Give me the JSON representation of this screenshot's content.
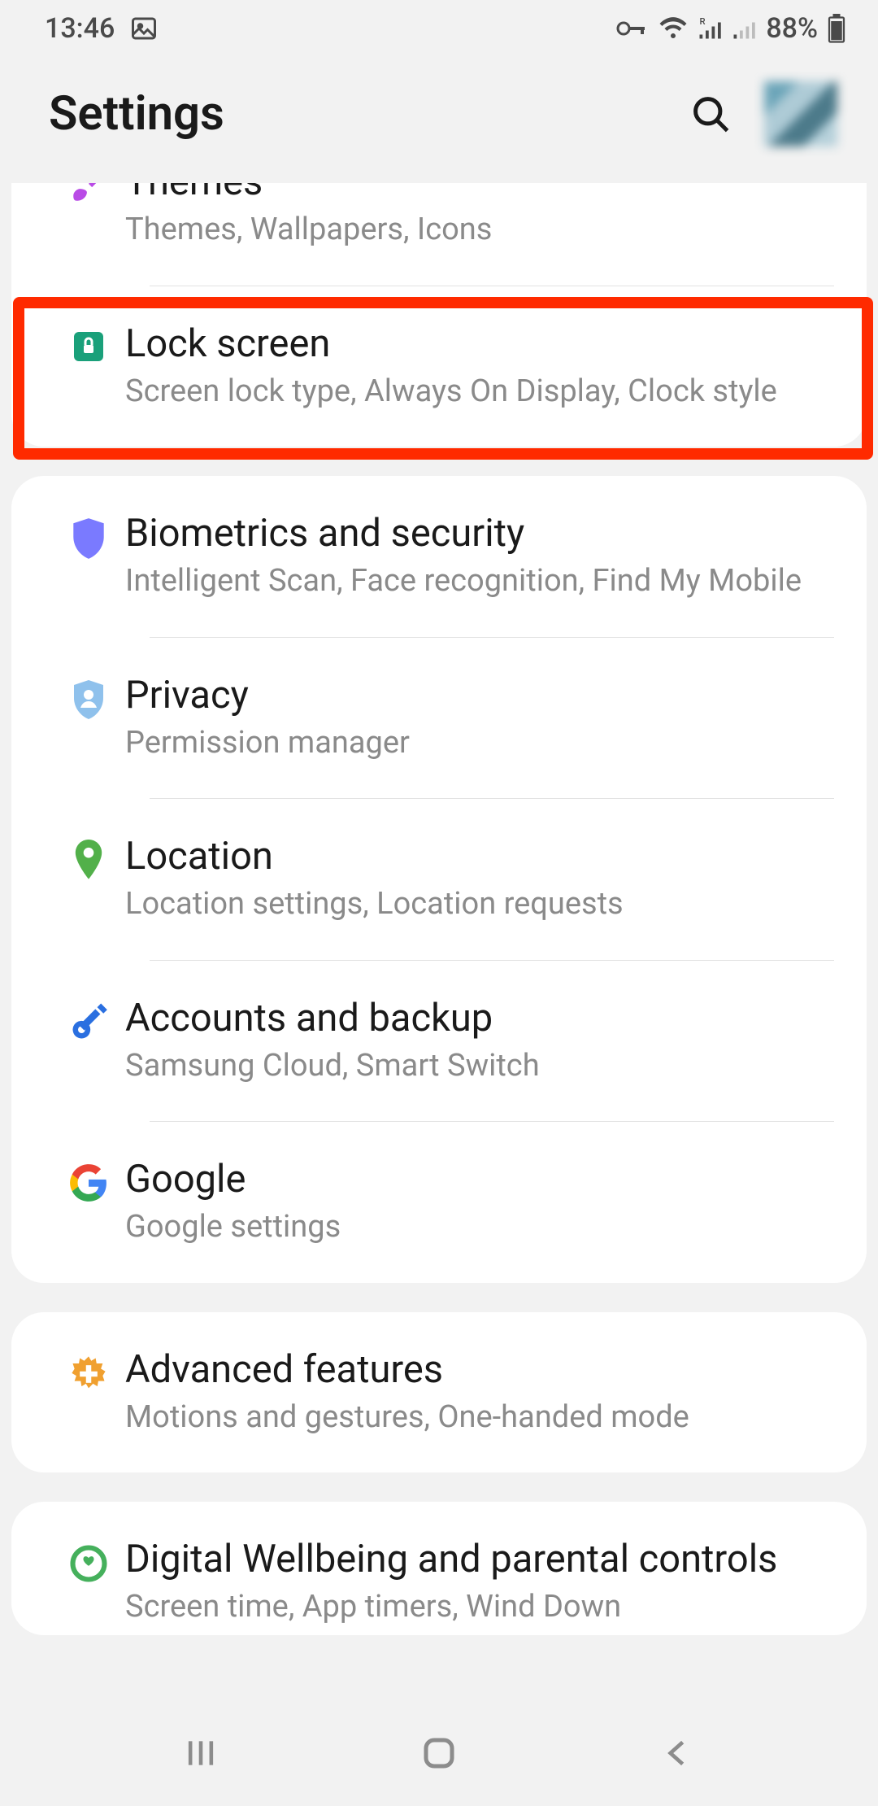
{
  "status": {
    "time": "13:46",
    "battery": "88%"
  },
  "header": {
    "title": "Settings"
  },
  "groups": [
    {
      "items": [
        {
          "icon": "brush-icon",
          "color": "#b94be6",
          "title": "Themes",
          "subtitle": "Themes, Wallpapers, Icons",
          "cutTop": true
        },
        {
          "icon": "lock-icon",
          "color": "#1aa07a",
          "title": "Lock screen",
          "subtitle": "Screen lock type, Always On Display, Clock style",
          "highlighted": true
        }
      ]
    },
    {
      "items": [
        {
          "icon": "shield-icon",
          "color": "#7a7aff",
          "title": "Biometrics and security",
          "subtitle": "Intelligent Scan, Face recognition, Find My Mobile"
        },
        {
          "icon": "shield-user-icon",
          "color": "#8fc1ec",
          "title": "Privacy",
          "subtitle": "Permission manager"
        },
        {
          "icon": "pin-icon",
          "color": "#52b04a",
          "title": "Location",
          "subtitle": "Location settings, Location requests"
        },
        {
          "icon": "key-icon",
          "color": "#2a6fe0",
          "title": "Accounts and backup",
          "subtitle": "Samsung Cloud, Smart Switch"
        },
        {
          "icon": "google-icon",
          "color": "#4285f4",
          "title": "Google",
          "subtitle": "Google settings"
        }
      ]
    },
    {
      "items": [
        {
          "icon": "gear-plus-icon",
          "color": "#f0a030",
          "title": "Advanced features",
          "subtitle": "Motions and gestures, One-handed mode"
        }
      ]
    },
    {
      "items": [
        {
          "icon": "wellbeing-icon",
          "color": "#45b05c",
          "title": "Digital Wellbeing and parental controls",
          "subtitle": "Screen time, App timers, Wind Down",
          "cutBottom": true
        }
      ]
    }
  ]
}
